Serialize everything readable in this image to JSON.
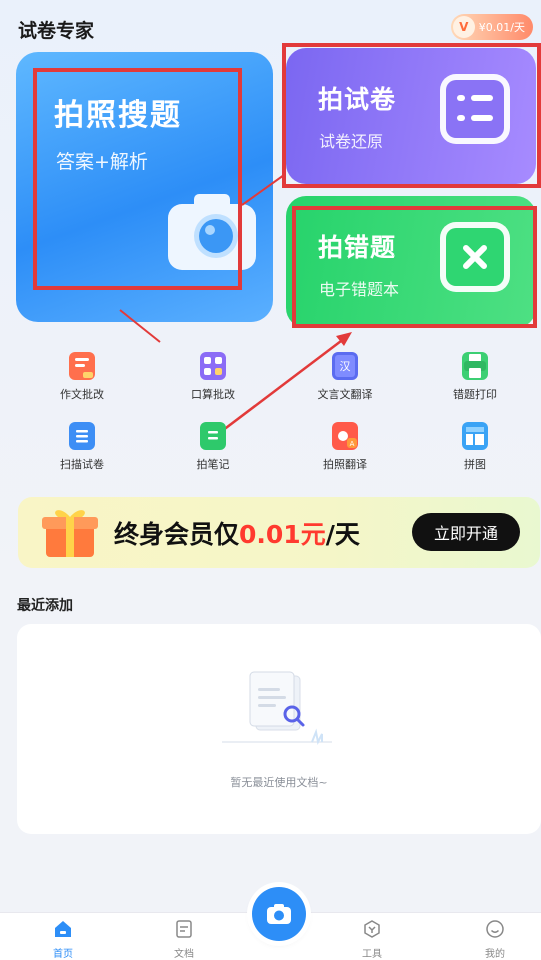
{
  "header": {
    "app_title": "试卷专家",
    "vip_badge_letter": "V",
    "vip_badge_text": "¥0.01/天"
  },
  "cards": {
    "photo_search": {
      "title": "拍照搜题",
      "subtitle": "答案+解析",
      "icon": "camera-icon"
    },
    "photo_exam": {
      "title": "拍试卷",
      "subtitle": "试卷还原",
      "icon": "list-icon"
    },
    "wrong_questions": {
      "title": "拍错题",
      "subtitle": "电子错题本",
      "icon": "close-icon"
    }
  },
  "tools": [
    {
      "label": "作文批改",
      "icon": "essay-icon"
    },
    {
      "label": "口算批改",
      "icon": "calculator-icon"
    },
    {
      "label": "文言文翻译",
      "icon": "translate-book-icon"
    },
    {
      "label": "错题打印",
      "icon": "printer-icon"
    },
    {
      "label": "扫描试卷",
      "icon": "scan-doc-icon"
    },
    {
      "label": "拍笔记",
      "icon": "note-icon"
    },
    {
      "label": "拍照翻译",
      "icon": "photo-translate-icon"
    },
    {
      "label": "拼图",
      "icon": "puzzle-icon"
    }
  ],
  "promo": {
    "text_prefix": "终身会员仅",
    "price": "0.01元",
    "text_suffix": "/天",
    "button": "立即开通"
  },
  "recent": {
    "title": "最近添加",
    "empty_text": "暂无最近使用文档~"
  },
  "bottom_nav": [
    {
      "label": "首页",
      "icon": "home-icon",
      "active": true
    },
    {
      "label": "文档",
      "icon": "document-icon",
      "active": false
    },
    {
      "label": "工具",
      "icon": "tools-icon",
      "active": false
    },
    {
      "label": "我的",
      "icon": "profile-icon",
      "active": false
    }
  ],
  "colors": {
    "accent_blue": "#2d8ef7",
    "exam_purple": "#8a73f5",
    "wrong_green": "#2fd672",
    "price_red": "#ff3a2f",
    "annotation_red": "#e23a3a"
  }
}
